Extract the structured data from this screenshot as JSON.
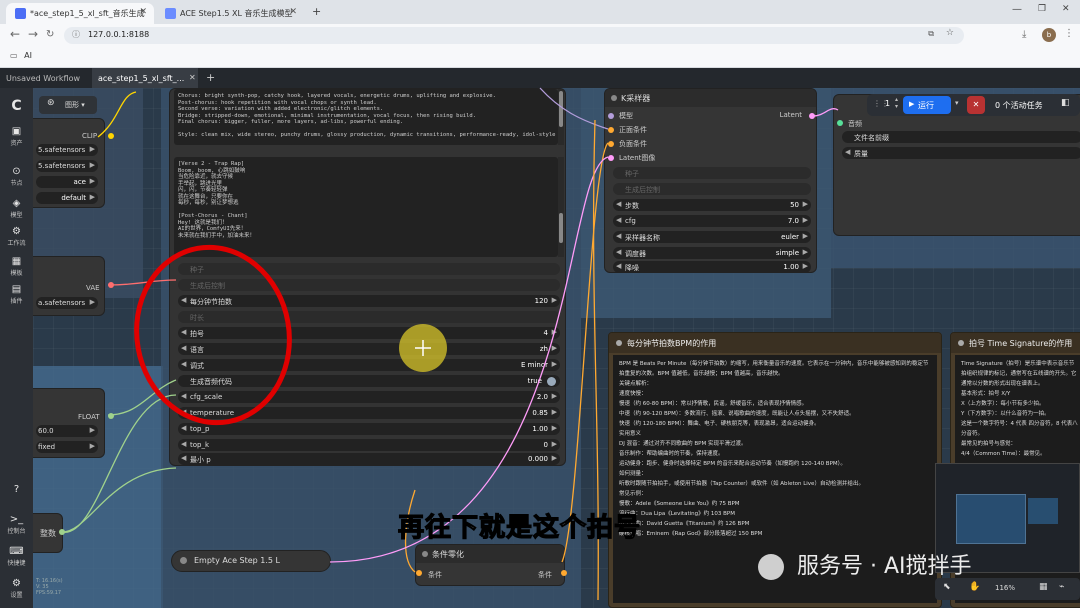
{
  "browser": {
    "tabs": [
      {
        "title": "*ace_step1_5_xl_sft_音乐生成"
      },
      {
        "title": "ACE Step1.5 XL 音乐生成模型"
      }
    ],
    "new_tab": "+",
    "url": "127.0.0.1:8188",
    "bookmark": "AI",
    "profile": "b"
  },
  "workflow_tabs": [
    {
      "label": "Unsaved Workflow"
    },
    {
      "label": "ace_step1_5_xl_sft_..."
    }
  ],
  "sidebar": {
    "items": [
      {
        "label": "资产",
        "icon": "image-icon"
      },
      {
        "label": "节点",
        "icon": "node-icon"
      },
      {
        "label": "模型",
        "icon": "cube-icon"
      },
      {
        "label": "工作流",
        "icon": "workflow-icon"
      },
      {
        "label": "模板",
        "icon": "template-icon"
      },
      {
        "label": "插件",
        "icon": "puzzle-icon"
      },
      {
        "label": "控制台",
        "icon": "console-icon"
      },
      {
        "label": "快捷键",
        "icon": "keyboard-icon"
      },
      {
        "label": "设置",
        "icon": "gear-icon"
      }
    ],
    "stats": [
      "T: 16.16(s)",
      "V: 35",
      "FPS:59.17"
    ]
  },
  "toolbar": {
    "graph_label": "图形",
    "queue_count": "1",
    "run_label": "运行",
    "active_tasks": "0 个活动任务"
  },
  "loader_node": {
    "clip_port": "CLIP",
    "vae_port": "VAE",
    "fields": [
      "5.safetensors",
      "5.safetensors",
      "ace",
      "default"
    ],
    "vae_field": "a.safetensors"
  },
  "float_node": {
    "port": "FLOAT",
    "value": "60.0",
    "mode": "fixed"
  },
  "int_node": {
    "label": "整数"
  },
  "text_node": {
    "lyrics_top": "Chorus: bright synth-pop, catchy hook, layered vocals, energetic drums, uplifting and explosive.\nPost-chorus: hook repetition with vocal chops or synth lead.\nSecond verse: variation with added electronic/glitch elements.\nBridge: stripped-down, emotional, minimal instrumentation, vocal focus, then rising build.\nFinal chorus: bigger, fuller, more layers, ad-libs, powerful ending.\n\nStyle: clean mix, wide stereo, punchy drums, glossy production, dynamic transitions, performance-ready, idol-style",
    "lyrics_bottom": "[Verse 2 - Trap Rap]\nBoom, boom, 心跳如鼓响\n当危险靠近，就去守候\n手举起，跳进光里\n闪，闪，节奏轻轻弹\n就在这舞台，只要你在\n每秒，每秒，别让梦想逃\n\n[Post-Chorus - Chant]\nHey! 这就是我们！\nAI的世界，ComfyUI先来！\n未来就在我们手中，加油未来！",
    "widgets": [
      {
        "label": "种子",
        "value": "",
        "dim": true
      },
      {
        "label": "生成后控制",
        "value": "",
        "dim": true
      },
      {
        "label": "每分钟节拍数",
        "value": "120"
      },
      {
        "label": "时长",
        "value": "",
        "dim": true
      },
      {
        "label": "拍号",
        "value": "4"
      },
      {
        "label": "语言",
        "value": "zh"
      },
      {
        "label": "调式",
        "value": "E minor"
      },
      {
        "label": "生成音频代码",
        "value": "true"
      },
      {
        "label": "cfg_scale",
        "value": "2.0"
      },
      {
        "label": "temperature",
        "value": "0.85"
      },
      {
        "label": "top_p",
        "value": "1.00"
      },
      {
        "label": "top_k",
        "value": "0"
      },
      {
        "label": "最小 p",
        "value": "0.000"
      }
    ]
  },
  "empty_latent_node": {
    "title": "Empty Ace Step 1.5 L"
  },
  "cond_zero_node": {
    "title": "条件零化",
    "input": "条件",
    "output": "条件"
  },
  "ksampler_node": {
    "title": "K采样器",
    "inputs": [
      "模型",
      "正面条件",
      "负面条件",
      "Latent图像"
    ],
    "output": "Latent",
    "widgets": [
      {
        "label": "种子",
        "value": "",
        "dim": true
      },
      {
        "label": "生成后控制",
        "value": "",
        "dim": true
      },
      {
        "label": "步数",
        "value": "50"
      },
      {
        "label": "cfg",
        "value": "7.0"
      },
      {
        "label": "采样器名称",
        "value": "euler"
      },
      {
        "label": "调度器",
        "value": "simple"
      },
      {
        "label": "降噪",
        "value": "1.00"
      }
    ]
  },
  "save_node": {
    "input": "音频",
    "fields": [
      "文件名前缀",
      "质量"
    ]
  },
  "note_bpm": {
    "title": "每分钟节拍数BPM的作用",
    "lines": [
      "BPM 是 Beats Per Minute（每分钟节拍数）的缩写，用来衡量音乐的速度。它表示在一分钟内，音乐中能够被感知到的稳定节拍重复的次数。BPM 值越低，音乐越慢；BPM 值越高，音乐越快。",
      "关键点解析：",
      "速度快慢：",
      "慢速（约 60-80 BPM）：常以抒情歌，民谣，舒缓音乐，适合表现抒情情感。",
      "中速（约 90-120 BPM）：多数流行、摇滚、说唱歌曲的速度，既能让人点头摇摆，又不失舒适。",
      "快速（约 120-180 BPM）：舞曲、电子、硬核朋克等，表现激昂，适合运动健身。",
      "实用意义",
      "DJ 混音：通过对齐不同歌曲的 BPM 实现平滑过渡。",
      "音乐制作：帮助编曲时的节奏，保持速度。",
      "运动健身：跑步、健身时选择特定 BPM 的音乐来配合运动节奏（如慢跑约 120-140 BPM）。",
      "如何测量：",
      "听歌时跟随节拍拍手，或使用节拍器（Tap Counter）或软件（如 Ableton Live）自动检测并给出。",
      "常见示例：",
      "慢歌：Adele《Someone Like You》约 75 BPM",
      "流行曲：Dua Lipa《Levitating》约 103 BPM",
      "电子舞曲：David Guetta《Titanium》约 126 BPM",
      "硬核说唱：Eminem《Rap God》部分段落超过 150 BPM"
    ]
  },
  "note_ts": {
    "title": "拍号 Time Signature的作用",
    "lines": [
      "Time Signature（拍号）是乐谱中表示音乐节拍组织规律的标记，通常写在五线谱的开头。它通常以分数的形式出现在谱表上。",
      "基本形式：拍号 X/Y",
      "X（上方数字）：每小节有多少拍。",
      "Y（下方数字）：以什么音符为一拍。",
      "这是一个数字符号：4 代表 四分音符，8 代表八分音符。",
      "最常见的拍号与感觉：",
      "4/4（Common Time）：最常见。"
    ]
  },
  "caption": "再往下就是这个拍号",
  "watermark": "服务号 · AI搅拌手",
  "zoom": "116%"
}
